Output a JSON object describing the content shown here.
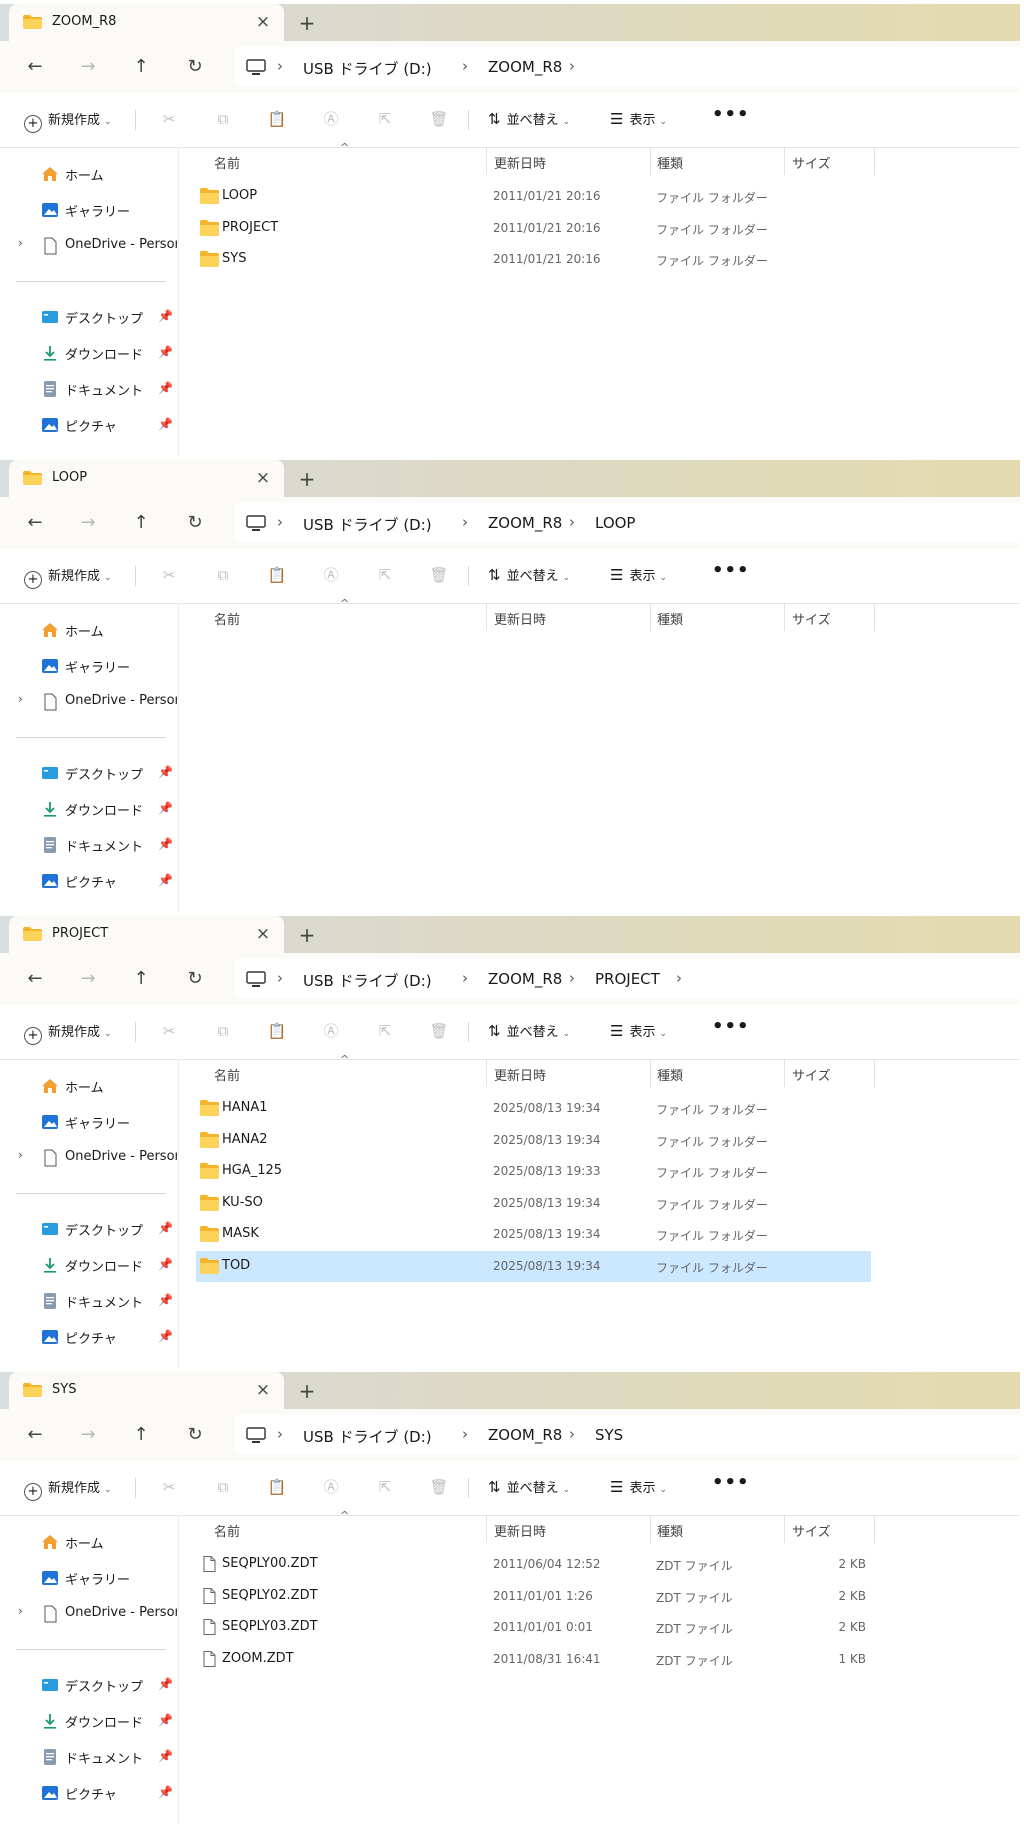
{
  "common": {
    "new_tab": "+",
    "close": "×",
    "new_label": "新規作成",
    "sort_label": "並べ替え",
    "view_label": "表示",
    "more_label": "•••",
    "nav": {
      "home": "ホーム",
      "gallery": "ギャラリー",
      "onedrive": "OneDrive - Personal",
      "desktop": "デスクトップ",
      "downloads": "ダウンロード",
      "documents": "ドキュメント",
      "pictures": "ピクチャ"
    },
    "columns": {
      "name": "名前",
      "date": "更新日時",
      "type": "種類",
      "size": "サイズ"
    }
  },
  "windows": [
    {
      "tab_title": "ZOOM_R8",
      "breadcrumbs": [
        "USB ドライブ (D:)",
        "ZOOM_R8"
      ],
      "trailing_chevron": true,
      "rows": [
        {
          "name": "LOOP",
          "date": "2011/01/21 20:16",
          "type": "ファイル フォルダー",
          "size": "",
          "icon": "folder-icon"
        },
        {
          "name": "PROJECT",
          "date": "2011/01/21 20:16",
          "type": "ファイル フォルダー",
          "size": "",
          "icon": "folder-icon"
        },
        {
          "name": "SYS",
          "date": "2011/01/21 20:16",
          "type": "ファイル フォルダー",
          "size": "",
          "icon": "folder-icon"
        }
      ]
    },
    {
      "tab_title": "LOOP",
      "breadcrumbs": [
        "USB ドライブ (D:)",
        "ZOOM_R8",
        "LOOP"
      ],
      "trailing_chevron": false,
      "rows": []
    },
    {
      "tab_title": "PROJECT",
      "breadcrumbs": [
        "USB ドライブ (D:)",
        "ZOOM_R8",
        "PROJECT"
      ],
      "trailing_chevron": true,
      "rows": [
        {
          "name": "HANA1",
          "date": "2025/08/13 19:34",
          "type": "ファイル フォルダー",
          "size": "",
          "icon": "folder-icon"
        },
        {
          "name": "HANA2",
          "date": "2025/08/13 19:34",
          "type": "ファイル フォルダー",
          "size": "",
          "icon": "folder-icon"
        },
        {
          "name": "HGA_125",
          "date": "2025/08/13 19:33",
          "type": "ファイル フォルダー",
          "size": "",
          "icon": "folder-icon"
        },
        {
          "name": "KU-SO",
          "date": "2025/08/13 19:34",
          "type": "ファイル フォルダー",
          "size": "",
          "icon": "folder-icon"
        },
        {
          "name": "MASK",
          "date": "2025/08/13 19:34",
          "type": "ファイル フォルダー",
          "size": "",
          "icon": "folder-icon"
        },
        {
          "name": "TOD",
          "date": "2025/08/13 19:34",
          "type": "ファイル フォルダー",
          "size": "",
          "icon": "folder-icon",
          "selected": true
        }
      ]
    },
    {
      "tab_title": "SYS",
      "breadcrumbs": [
        "USB ドライブ (D:)",
        "ZOOM_R8",
        "SYS"
      ],
      "trailing_chevron": false,
      "rows": [
        {
          "name": "SEQPLY00.ZDT",
          "date": "2011/06/04 12:52",
          "type": "ZDT ファイル",
          "size": "2 KB",
          "icon": "file-icon"
        },
        {
          "name": "SEQPLY02.ZDT",
          "date": "2011/01/01 1:26",
          "type": "ZDT ファイル",
          "size": "2 KB",
          "icon": "file-icon"
        },
        {
          "name": "SEQPLY03.ZDT",
          "date": "2011/01/01 0:01",
          "type": "ZDT ファイル",
          "size": "2 KB",
          "icon": "file-icon"
        },
        {
          "name": "ZOOM.ZDT",
          "date": "2011/08/31 16:41",
          "type": "ZDT ファイル",
          "size": "1 KB",
          "icon": "file-icon"
        }
      ]
    }
  ]
}
